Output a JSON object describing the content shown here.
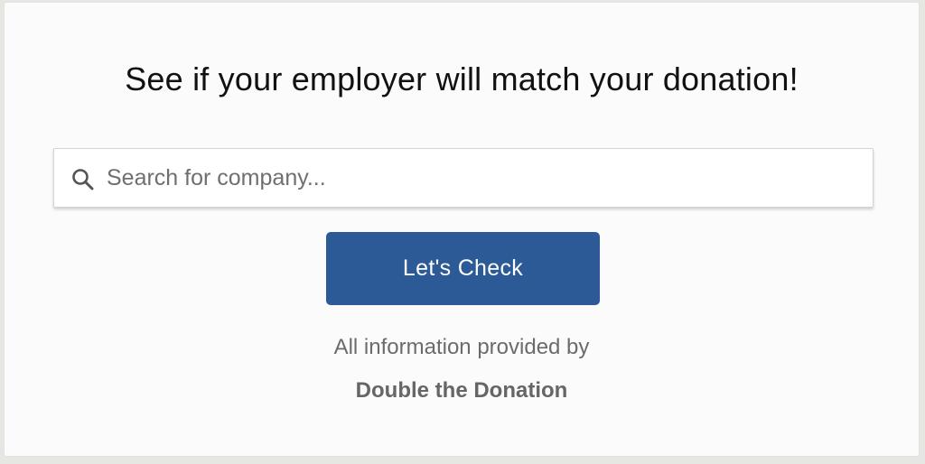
{
  "widget": {
    "title": "See if your employer will match your donation!",
    "search": {
      "placeholder": "Search for company...",
      "value": "",
      "icon": "search-icon"
    },
    "button_label": "Let's Check",
    "info_text": "All information provided by",
    "provider": "Double the Donation"
  },
  "colors": {
    "accent": "#2b5a97",
    "background": "#fbfbfb",
    "muted_text": "#6b6b6b"
  }
}
